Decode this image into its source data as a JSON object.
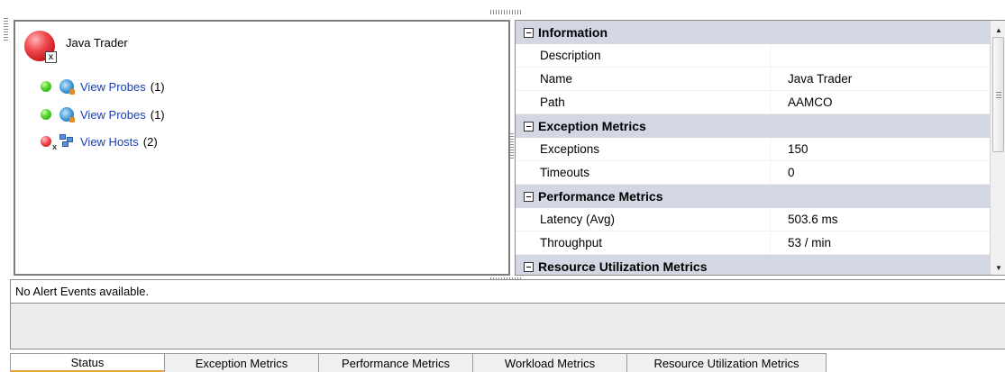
{
  "tree": {
    "root_label": "Java Trader",
    "root_badge": "x",
    "children": [
      {
        "label": "View Probes",
        "count": "(1)",
        "status": "ok",
        "icon": "probe-icon"
      },
      {
        "label": "View Probes",
        "count": "(1)",
        "status": "ok",
        "icon": "probe-icon"
      },
      {
        "label": "View Hosts",
        "count": "(2)",
        "status": "error",
        "icon": "hosts-icon"
      }
    ]
  },
  "properties": {
    "sections": [
      {
        "title": "Information",
        "rows": [
          {
            "name": "Description",
            "value": ""
          },
          {
            "name": "Name",
            "value": "Java Trader"
          },
          {
            "name": "Path",
            "value": "AAMCO"
          }
        ]
      },
      {
        "title": "Exception Metrics",
        "rows": [
          {
            "name": "Exceptions",
            "value": "150"
          },
          {
            "name": "Timeouts",
            "value": "0"
          }
        ]
      },
      {
        "title": "Performance Metrics",
        "rows": [
          {
            "name": "Latency (Avg)",
            "value": "503.6 ms"
          },
          {
            "name": "Throughput",
            "value": "53 / min"
          }
        ]
      },
      {
        "title": "Resource Utilization Metrics",
        "rows": []
      }
    ],
    "colors": {
      "section_bg": "#d3d7e3"
    }
  },
  "alerts": {
    "message": "No Alert Events available."
  },
  "tabs": [
    {
      "label": "Status",
      "active": true
    },
    {
      "label": "Exception Metrics",
      "active": false
    },
    {
      "label": "Performance Metrics",
      "active": false
    },
    {
      "label": "Workload Metrics",
      "active": false
    },
    {
      "label": "Resource Utilization Metrics",
      "active": false
    }
  ],
  "colors": {
    "link": "#1a3fb0",
    "tab_active_underline": "#e8a23a"
  }
}
